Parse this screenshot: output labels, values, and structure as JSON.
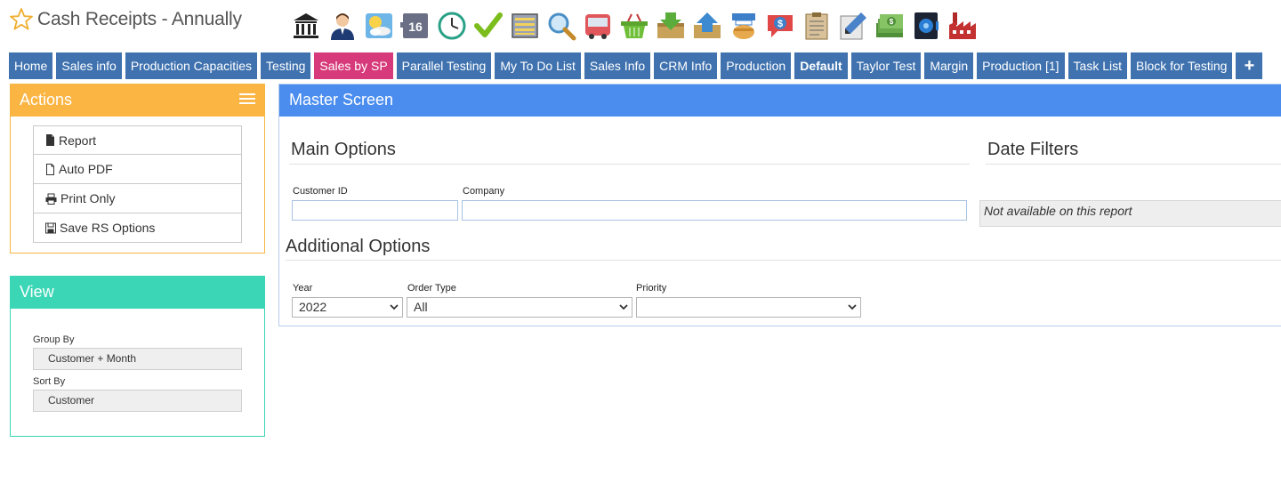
{
  "header": {
    "title": "Cash Receipts - Annually",
    "icons": [
      "bank-icon",
      "user-icon",
      "weather-icon",
      "calendar-icon",
      "clock-icon",
      "checkmark-icon",
      "list-icon",
      "search-icon",
      "bus-icon",
      "basket-icon",
      "download-icon",
      "upload-icon",
      "hand-money-icon",
      "dollar-chat-icon",
      "clipboard-icon",
      "pencil-icon",
      "cash-icon",
      "safe-icon",
      "factory-icon"
    ],
    "calendar_day": "16"
  },
  "tabs": [
    {
      "label": "Home"
    },
    {
      "label": "Sales info"
    },
    {
      "label": "Production Capacities"
    },
    {
      "label": "Testing"
    },
    {
      "label": "Sales by SP"
    },
    {
      "label": "Parallel Testing"
    },
    {
      "label": "My To Do List"
    },
    {
      "label": "Sales Info"
    },
    {
      "label": "CRM Info"
    },
    {
      "label": "Production"
    },
    {
      "label": "Default"
    },
    {
      "label": "Taylor Test"
    },
    {
      "label": "Margin"
    },
    {
      "label": "Production [1]"
    },
    {
      "label": "Task List"
    },
    {
      "label": "Block for Testing"
    },
    {
      "label": "+"
    }
  ],
  "actions": {
    "title": "Actions",
    "buttons": [
      {
        "label": "Report",
        "icon": "file-filled-icon"
      },
      {
        "label": "Auto PDF",
        "icon": "file-outline-icon"
      },
      {
        "label": "Print Only",
        "icon": "printer-icon"
      },
      {
        "label": "Save RS Options",
        "icon": "floppy-icon"
      }
    ]
  },
  "view": {
    "title": "View",
    "group_by_label": "Group By",
    "group_by_value": "Customer + Month",
    "sort_by_label": "Sort By",
    "sort_by_value": "Customer"
  },
  "master": {
    "title": "Master Screen",
    "main_options": "Main Options",
    "date_filters": "Date Filters",
    "customer_id_label": "Customer ID",
    "customer_id_value": "",
    "company_label": "Company",
    "company_value": "",
    "date_filters_note": "Not available on this report",
    "additional_options": "Additional Options",
    "year_label": "Year",
    "year_value": "2022",
    "order_type_label": "Order Type",
    "order_type_value": "All",
    "priority_label": "Priority",
    "priority_value": ""
  },
  "colors": {
    "tab": "#3f72af",
    "tab_active": "#d63a7a",
    "actions": "#fbb543",
    "view": "#3ad6b5",
    "master": "#4a8def"
  }
}
